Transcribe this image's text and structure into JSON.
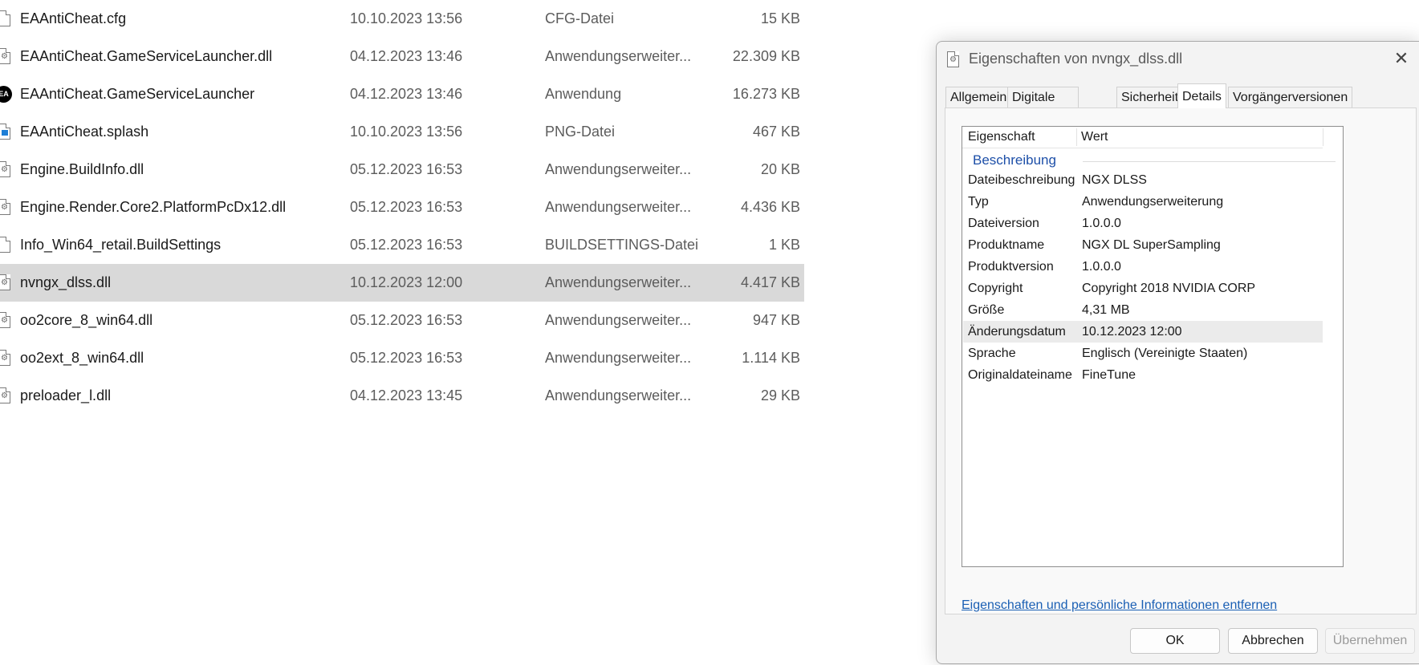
{
  "files": [
    {
      "name": "EAAntiCheat.cfg",
      "date": "10.10.2023 13:56",
      "type": "CFG-Datei",
      "size": "15 KB",
      "icon": "document-icon"
    },
    {
      "name": "EAAntiCheat.GameServiceLauncher.dll",
      "date": "04.12.2023 13:46",
      "type": "Anwendungserweiter...",
      "size": "22.309 KB",
      "icon": "dll-icon"
    },
    {
      "name": "EAAntiCheat.GameServiceLauncher",
      "date": "04.12.2023 13:46",
      "type": "Anwendung",
      "size": "16.273 KB",
      "icon": "ea-logo-icon"
    },
    {
      "name": "EAAntiCheat.splash",
      "date": "10.10.2023 13:56",
      "type": "PNG-Datei",
      "size": "467 KB",
      "icon": "image-file-icon"
    },
    {
      "name": "Engine.BuildInfo.dll",
      "date": "05.12.2023 16:53",
      "type": "Anwendungserweiter...",
      "size": "20 KB",
      "icon": "dll-icon"
    },
    {
      "name": "Engine.Render.Core2.PlatformPcDx12.dll",
      "date": "05.12.2023 16:53",
      "type": "Anwendungserweiter...",
      "size": "4.436 KB",
      "icon": "dll-icon"
    },
    {
      "name": "Info_Win64_retail.BuildSettings",
      "date": "05.12.2023 16:53",
      "type": "BUILDSETTINGS-Datei",
      "size": "1 KB",
      "icon": "document-icon"
    },
    {
      "name": "nvngx_dlss.dll",
      "date": "10.12.2023 12:00",
      "type": "Anwendungserweiter...",
      "size": "4.417 KB",
      "icon": "dll-icon",
      "selected": true
    },
    {
      "name": "oo2core_8_win64.dll",
      "date": "05.12.2023 16:53",
      "type": "Anwendungserweiter...",
      "size": "947 KB",
      "icon": "dll-icon"
    },
    {
      "name": "oo2ext_8_win64.dll",
      "date": "05.12.2023 16:53",
      "type": "Anwendungserweiter...",
      "size": "1.114 KB",
      "icon": "dll-icon"
    },
    {
      "name": "preloader_l.dll",
      "date": "04.12.2023 13:45",
      "type": "Anwendungserweiter...",
      "size": "29 KB",
      "icon": "dll-icon"
    }
  ],
  "dialog": {
    "title": "Eigenschaften von nvngx_dlss.dll",
    "close_glyph": "✕",
    "tabs": [
      {
        "label": "Allgemein"
      },
      {
        "label": "Digitale Signaturen"
      },
      {
        "label": "Sicherheit"
      },
      {
        "label": "Details",
        "active": true
      },
      {
        "label": "Vorgängerversionen"
      }
    ],
    "columns": {
      "property": "Eigenschaft",
      "value": "Wert"
    },
    "group": "Beschreibung",
    "rows": [
      {
        "key": "Dateibeschreibung",
        "value": "NGX DLSS"
      },
      {
        "key": "Typ",
        "value": "Anwendungserweiterung"
      },
      {
        "key": "Dateiversion",
        "value": "1.0.0.0"
      },
      {
        "key": "Produktname",
        "value": "NGX DL SuperSampling"
      },
      {
        "key": "Produktversion",
        "value": "1.0.0.0"
      },
      {
        "key": "Copyright",
        "value": "Copyright 2018 NVIDIA CORP"
      },
      {
        "key": "Größe",
        "value": "4,31 MB"
      },
      {
        "key": "Änderungsdatum",
        "value": "10.12.2023 12:00",
        "selected": true
      },
      {
        "key": "Sprache",
        "value": "Englisch (Vereinigte Staaten)"
      },
      {
        "key": "Originaldateiname",
        "value": "FineTune"
      }
    ],
    "remove_link": "Eigenschaften und persönliche Informationen entfernen",
    "buttons": {
      "ok": "OK",
      "cancel": "Abbrechen",
      "apply": "Übernehmen"
    }
  }
}
